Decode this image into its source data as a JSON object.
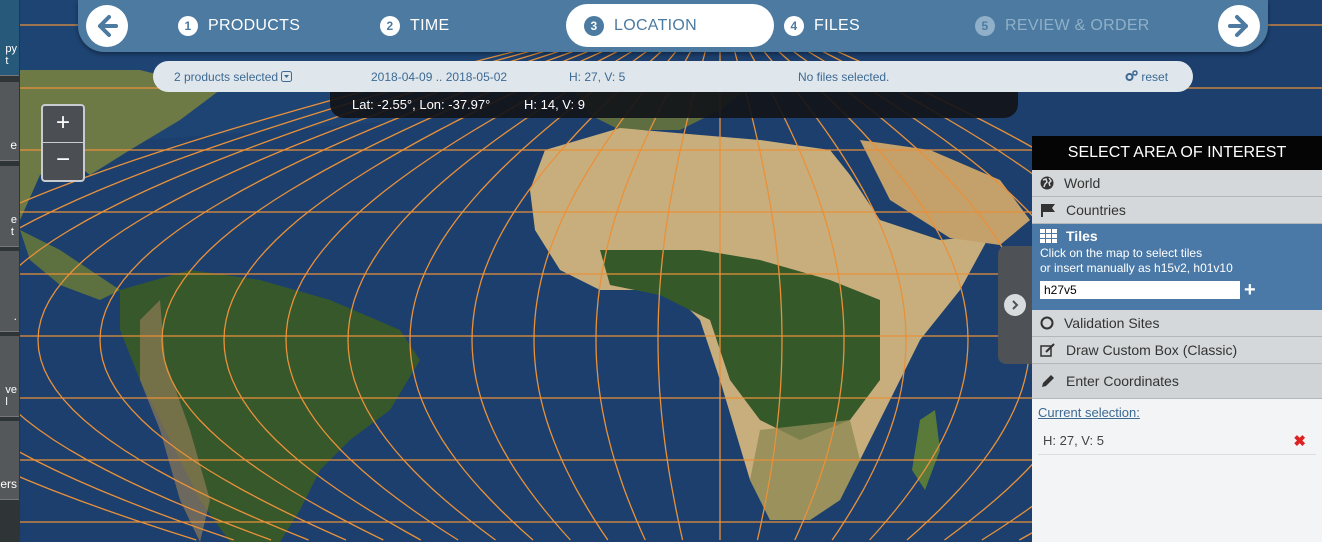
{
  "stepper": {
    "steps": [
      {
        "num": "1",
        "label": "PRODUCTS"
      },
      {
        "num": "2",
        "label": "TIME"
      },
      {
        "num": "3",
        "label": "LOCATION"
      },
      {
        "num": "4",
        "label": "FILES"
      },
      {
        "num": "5",
        "label": "REVIEW & ORDER"
      }
    ]
  },
  "infobar": {
    "products": "2 products selected",
    "dates": "2018-04-09 .. 2018-05-02",
    "tile": "H: 27, V: 5",
    "files": "No files selected.",
    "reset": "reset"
  },
  "coords": {
    "latlon": "Lat: -2.55°, Lon: -37.97°",
    "tile": "H: 14, V: 9"
  },
  "zoom": {
    "in": "+",
    "out": "−"
  },
  "left_tabs": [
    "py\nt",
    "e",
    "e\nt",
    ".",
    "ve\nl",
    "ers"
  ],
  "panel": {
    "title": "SELECT AREA OF INTEREST",
    "world": "World",
    "countries": "Countries",
    "tiles": {
      "title": "Tiles",
      "hint1": "Click on the map to select tiles",
      "hint2": "or insert manually as h15v2, h01v10",
      "value": "h27v5"
    },
    "validation": "Validation Sites",
    "draw": "Draw Custom Box (Classic)",
    "coords": "Enter Coordinates",
    "current_label": "Current selection:",
    "selection": "H: 27, V: 5"
  },
  "colors": {
    "accent": "#4c7aa0",
    "grid": "#e8913a",
    "ocean": "#1c3f6e"
  }
}
